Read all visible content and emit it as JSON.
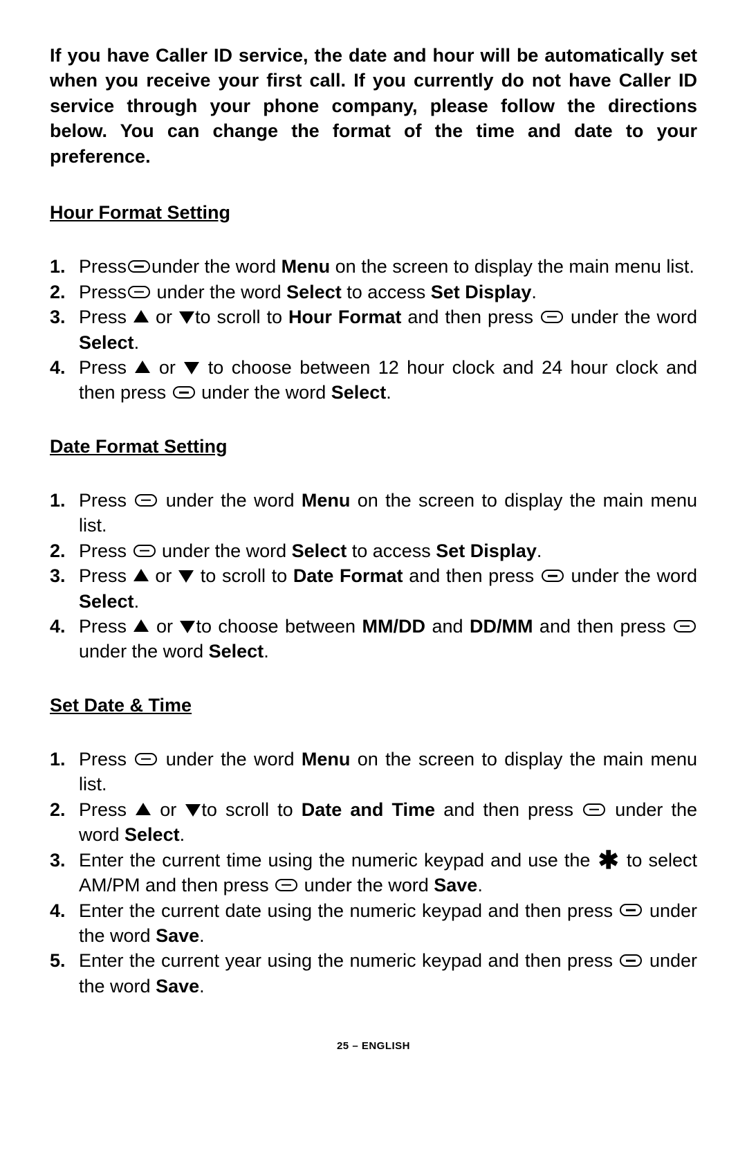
{
  "intro": "If you have Caller ID service, the date and hour will be automatically set when you receive your first call. If you currently do not have Caller ID service through your phone company, please follow the directions below.  You can change the format of the time and date to your preference.",
  "sections": {
    "hourFormat": {
      "heading": "Hour Format Setting",
      "steps": {
        "s1a": "Press",
        "s1b": "under the word ",
        "s1c": "Menu",
        "s1d": " on the screen to display the main menu list.",
        "s2a": "Press",
        "s2b": " under the word ",
        "s2c": "Select",
        "s2d": " to access ",
        "s2e": "Set Display",
        "s2f": ".",
        "s3a": "Press ",
        "s3b": "or ",
        "s3c": "to scroll to ",
        "s3d": "Hour Format",
        "s3e": " and then press ",
        "s3f": "under the word ",
        "s3g": "Select",
        "s3h": ".",
        "s4a": "Press ",
        "s4b": " or ",
        "s4c": " to choose between 12 hour clock and 24 hour clock and then press ",
        "s4d": "under the word ",
        "s4e": "Select",
        "s4f": "."
      }
    },
    "dateFormat": {
      "heading": "Date Format Setting",
      "steps": {
        "s1a": "Press ",
        "s1b": "under the word ",
        "s1c": "Menu",
        "s1d": " on the screen to display the main menu list.",
        "s2a": "Press ",
        "s2b": " under the word ",
        "s2c": "Select",
        "s2d": " to access ",
        "s2e": "Set Display",
        "s2f": ".",
        "s3a": "Press ",
        "s3b": "or ",
        "s3c": " to scroll to ",
        "s3d": "Date Format",
        "s3e": " and then press ",
        "s3f": "under the word ",
        "s3g": "Select",
        "s3h": ".",
        "s4a": "Press ",
        "s4b": "or ",
        "s4c": "to choose between ",
        "s4d": "MM/DD",
        "s4e": " and ",
        "s4f": "DD/MM",
        "s4g": " and then press ",
        "s4h": " under the word ",
        "s4i": "Select",
        "s4j": "."
      }
    },
    "setDateTime": {
      "heading": "Set Date & Time",
      "steps": {
        "s1a": "Press ",
        "s1b": "under the word ",
        "s1c": "Menu",
        "s1d": " on the screen to display the main menu list.",
        "s2a": "Press ",
        "s2b": "or ",
        "s2c": "to scroll to ",
        "s2d": "Date and Time",
        "s2e": " and then press ",
        "s2f": "under the word ",
        "s2g": "Select",
        "s2h": ".",
        "s3a": "Enter the current time using the numeric keypad and use the ",
        "s3b": " to select AM/PM and then press ",
        "s3c": "  under the word ",
        "s3d": "Save",
        "s3e": ".",
        "s4a": "Enter the current date using the numeric keypad and then press ",
        "s4b": "under the word ",
        "s4c": "Save",
        "s4d": ".",
        "s5a": "Enter the current year using the numeric keypad and then press ",
        "s5b": "under the word ",
        "s5c": "Save",
        "s5d": "."
      }
    }
  },
  "footer": "25 – ENGLISH"
}
